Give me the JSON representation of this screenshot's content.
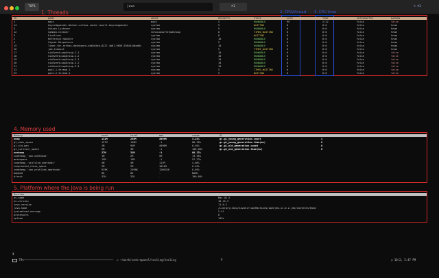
{
  "titlebar": {
    "tabs": [
      {
        "label": "TOP1"
      },
      {
        "label": "java"
      },
      {
        "label": "⌘1"
      },
      {
        "label": "⌥ ⌘1"
      }
    ]
  },
  "annotations": {
    "threads": "1. Threads",
    "cpu_thread": "2. CPU/thread",
    "cpu_time": "3. CPU time",
    "memory": "4. Memory used",
    "platform": "5. Platform where the Java is being run"
  },
  "threads": {
    "columns": [
      "ID",
      "NAME",
      "GROUP",
      "PRIORITY",
      "STATE",
      "%CPU",
      "TIME",
      "INTERRUPTED",
      "DAEMON"
    ],
    "rows": [
      [
        "1",
        "main",
        "main",
        "5",
        "RUNNABLE",
        "99",
        "2:22",
        "false",
        "false"
      ],
      [
        "14",
        "AsyncAppender-Worker-arthas-cache.result.AsyncAppender",
        "system",
        "9",
        "WAITING",
        "0",
        "0:0",
        "false",
        "true"
      ],
      [
        "3",
        "Attach Listener",
        "system",
        "9",
        "RUNNABLE",
        "0",
        "0:0",
        "false",
        "true"
      ],
      [
        "12",
        "Common-Cleaner",
        "InnocuousThreadGroup",
        "8",
        "TIMED_WAITING",
        "0",
        "0:0",
        "false",
        "true"
      ],
      [
        "3",
        "Finalizer",
        "system",
        "8",
        "WAITING",
        "0",
        "0:0",
        "false",
        "true"
      ],
      [
        "2",
        "Reference Handler",
        "system",
        "10",
        "RUNNABLE",
        "0",
        "0:0",
        "false",
        "true"
      ],
      [
        "4",
        "Signal Dispatcher",
        "system",
        "9",
        "RUNNABLE",
        "0",
        "0:0",
        "false",
        "true"
      ],
      [
        "15",
        "Timer-for-arthas-dashboard-da02a5ed-8227-4a01-9659-536441dbad6c",
        "system",
        "10",
        "RUNNABLE",
        "0",
        "0:0",
        "false",
        "true"
      ],
      [
        "16",
        "job-timeout",
        "system",
        "5",
        "TIMED_WAITING",
        "0",
        "0:0",
        "false",
        "true"
      ],
      [
        "17",
        "nioEventLoopGroup-2-1",
        "system",
        "10",
        "RUNNABLE",
        "0",
        "0:0",
        "false",
        "false"
      ],
      [
        "18",
        "nioEventLoopGroup-2-2",
        "system",
        "10",
        "RUNNABLE",
        "0",
        "0:0",
        "false",
        "false"
      ],
      [
        "19",
        "nioEventLoopGroup-3-1",
        "system",
        "10",
        "RUNNABLE",
        "0",
        "0:0",
        "false",
        "false"
      ],
      [
        "20",
        "nioEventLoopGroup-3-2",
        "system",
        "10",
        "RUNNABLE",
        "0",
        "0:0",
        "false",
        "false"
      ],
      [
        "21",
        "nioEventLoopGroup-3-3",
        "system",
        "10",
        "RUNNABLE",
        "0",
        "0:0",
        "false",
        "false"
      ],
      [
        "22",
        "pool-1-thread-1",
        "system",
        "5",
        "TIMED_WAITING",
        "0",
        "0:0",
        "false",
        "false"
      ],
      [
        "23",
        "pool-2-thread-1",
        "system",
        "5",
        "WAITING",
        "0",
        "0:0",
        "false",
        "false"
      ]
    ]
  },
  "memory": {
    "columns": [
      "Memory",
      "used",
      "total",
      "max",
      "usage",
      "GC",
      "",
      ""
    ],
    "rows": [
      [
        "heap",
        "132M",
        "256M",
        "4096M",
        "3.23%",
        "gc.g1_young_generation.count",
        "1",
        ""
      ],
      [
        "g1_eden_space",
        "127M",
        "158M",
        "-1",
        "80.38%",
        "gc.g1_young_generation.time(ms)",
        "8",
        ""
      ],
      [
        "g1_old_gen",
        "2M",
        "95M",
        "4096M",
        "0.05%",
        "gc.g1_old_generation.count",
        "0",
        ""
      ],
      [
        "g1_survivor_space",
        "3M",
        "3M",
        "-1",
        "100.00%",
        "gc.g1_old_generation.time(ms)",
        "0",
        ""
      ],
      [
        "nonheap",
        "27M",
        "31M",
        "-1",
        "88.23%",
        "",
        "",
        ""
      ],
      [
        "codeheap_'non-nmethods'",
        "1M",
        "2M",
        "5M",
        "19.56%",
        "",
        "",
        ""
      ],
      [
        "metaspace",
        "19M",
        "19M",
        "-1",
        "97.23%",
        "",
        "",
        ""
      ],
      [
        "codeheap_'profiled_nmethods'",
        "4M",
        "4M",
        "117M",
        "4.06%",
        "",
        "",
        ""
      ],
      [
        "compressed_class_space",
        "2M",
        "2M",
        "1024M",
        "0.20%",
        "",
        "",
        ""
      ],
      [
        "codeheap_'non-profiled_nmethods'",
        "929K",
        "2496K",
        "120032K",
        "0.69%",
        "",
        "",
        ""
      ],
      [
        "mapped",
        "0K",
        "0K",
        "-",
        "NaN%",
        "",
        "",
        ""
      ],
      [
        "direct",
        "32K",
        "32K",
        "-",
        "100.00%",
        "",
        "",
        ""
      ]
    ]
  },
  "runtime": {
    "columns": [
      "Runtime",
      ""
    ],
    "rows": [
      [
        "os.name",
        "Mac OS X"
      ],
      [
        "os.version",
        "10.15.3"
      ],
      [
        "java.version",
        "11.0.2"
      ],
      [
        "java.home",
        "/Library/Java/JavaVirtualMachines/openjdk-11.0.2.jdk/Contents/Home"
      ],
      [
        "systemload.average",
        "2.41"
      ],
      [
        "processors",
        "8"
      ],
      [
        "uptime",
        "143s"
      ]
    ]
  },
  "statusbar": {
    "battery": "79%",
    "path": "~/work/centrepanel/tooling/tooling",
    "branch": "P",
    "clock": "10/2, 3:47 PM"
  },
  "colors": {
    "annotation_red": "#d22a2a",
    "annotation_blue": "#2a4bd2",
    "header_bg": "#c8a98a"
  }
}
